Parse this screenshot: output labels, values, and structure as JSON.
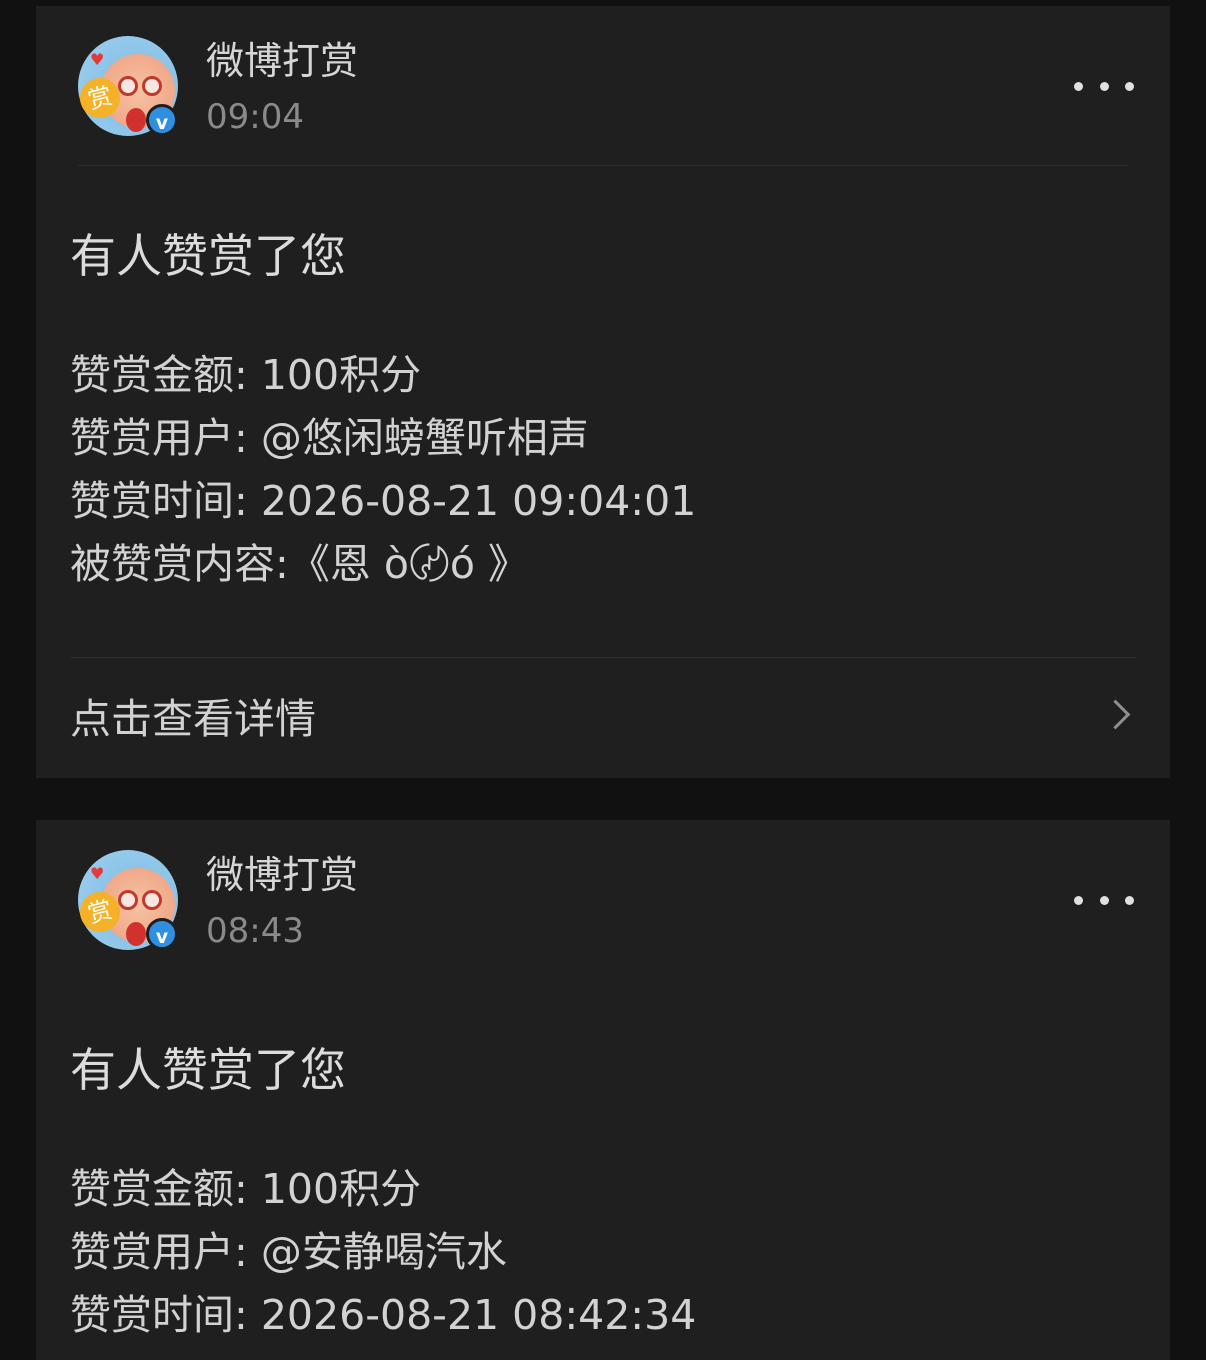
{
  "notifications": [
    {
      "sender": "微博打赏",
      "time": "09:04",
      "title": "有人赞赏了您",
      "details": [
        "赞赏金额: 100积分",
        "赞赏用户: @悠闲螃蟹听相声",
        "赞赏时间: 2026-08-21 09:04:01",
        "被赞赏内容:《恩 ò〄ó 》"
      ],
      "action_label": "点击查看详情"
    },
    {
      "sender": "微博打赏",
      "time": "08:43",
      "title": "有人赞赏了您",
      "details": [
        "赞赏金额: 100积分",
        "赞赏用户: @安静喝汽水",
        "赞赏时间: 2026-08-21 08:42:34"
      ]
    }
  ],
  "avatar": {
    "badge_text": "赏",
    "verified_icon": "v",
    "icon_names": [
      "reward-avatar-icon",
      "verified-badge-icon"
    ]
  },
  "icons": {
    "more": "more-dots-icon",
    "chevron": "chevron-right-icon"
  },
  "colors": {
    "background": "#111111",
    "card": "#1f1f1f",
    "text_primary": "#d6d6d6",
    "text_secondary": "#8a8a8a",
    "verified_blue": "#2f8fe0",
    "badge_orange": "#f5b128"
  }
}
